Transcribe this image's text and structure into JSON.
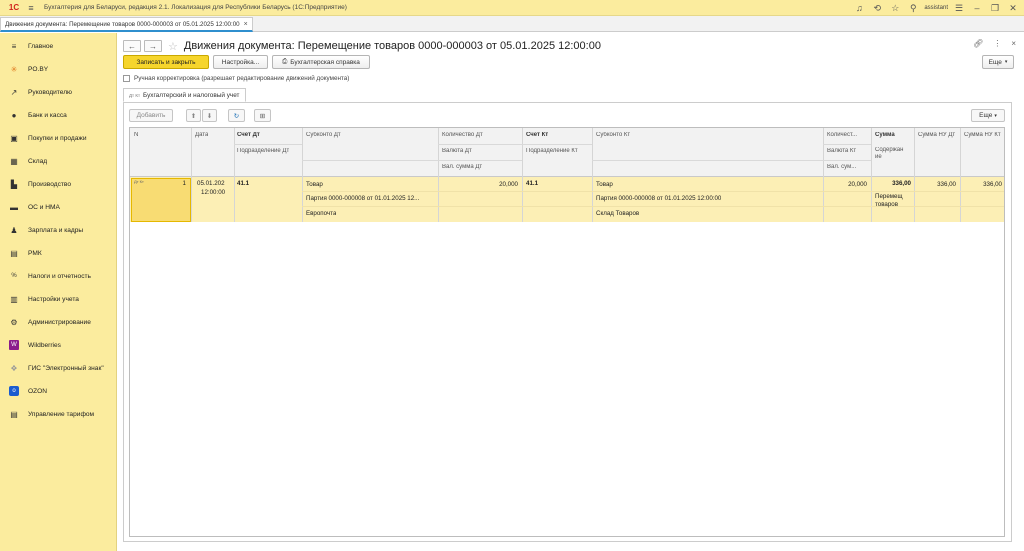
{
  "app": {
    "title": "Бухгалтерия для Беларуси, редакция 2.1. Локализация для Республики Беларусь  (1С:Предприятие)",
    "user": "assistant",
    "logo": "1С"
  },
  "tab": {
    "label": "Движения документа: Перемещение товаров 0000-000003 от 05.01.2025 12:00:00"
  },
  "sidebar": {
    "items": [
      {
        "label": "Главное",
        "icon": "hamburger-icon"
      },
      {
        "label": "PO.BY",
        "icon": "sparkle-icon"
      },
      {
        "label": "Руководителю",
        "icon": "trend-icon"
      },
      {
        "label": "Банк и касса",
        "icon": "bank-icon"
      },
      {
        "label": "Покупки и продажи",
        "icon": "cart-icon"
      },
      {
        "label": "Склад",
        "icon": "warehouse-icon"
      },
      {
        "label": "Производство",
        "icon": "factory-icon"
      },
      {
        "label": "ОС и НМА",
        "icon": "truck-icon"
      },
      {
        "label": "Зарплата и кадры",
        "icon": "person-icon"
      },
      {
        "label": "РМК",
        "icon": "register-icon"
      },
      {
        "label": "Налоги и отчетность",
        "icon": "tax-icon"
      },
      {
        "label": "Настройки учета",
        "icon": "folder-icon"
      },
      {
        "label": "Администрирование",
        "icon": "gear-icon"
      },
      {
        "label": "Wildberries",
        "icon": "wb-icon"
      },
      {
        "label": "ГИС \"Электронный знак\"",
        "icon": "diamond-icon"
      },
      {
        "label": "OZON",
        "icon": "ozon-icon"
      },
      {
        "label": "Управление тарифом",
        "icon": "list-icon"
      }
    ]
  },
  "header": {
    "title": "Движения документа: Перемещение товаров 0000-000003 от 05.01.2025 12:00:00"
  },
  "toolbar": {
    "save_close": "Записать и закрыть",
    "settings": "Настройка...",
    "report": "Бухгалтерская справка",
    "more": "Еще"
  },
  "manual": {
    "label": "Ручная корректировка (разрешает редактирование движений документа)"
  },
  "subtab": {
    "label": "Бухгалтерский и налоговый учет",
    "icon_text": "Дт Кт"
  },
  "panel": {
    "add": "Добавить",
    "more": "Еще"
  },
  "grid": {
    "headers": {
      "n": "N",
      "date": "Дата",
      "acc_dt": "Счет Дт",
      "div_dt": "Подразделение Дт",
      "sub_dt": "Субконто Дт",
      "qty_dt": "Количество Дт",
      "cur_dt": "Валюта Дт",
      "cur_sum_dt": "Вал. сумма Дт",
      "acc_kt": "Счет Кт",
      "div_kt": "Подразделение Кт",
      "sub_kt": "Субконто Кт",
      "qty_kt": "Количест...",
      "cur_kt": "Валюта Кт",
      "cur_sum_kt": "Вал. сум...",
      "sum": "Сумма",
      "content": "Содержан ие",
      "sum_nu_dt": "Сумма НУ Дт",
      "sum_nu_kt": "Сумма НУ Кт"
    },
    "row": {
      "icon_text": "Дт Кт",
      "n": "1",
      "date": "05.01.202",
      "time": "12:00:00",
      "acc_dt": "41.1",
      "sub_dt_1": "Товар",
      "sub_dt_2": "Партия 0000-000008 от 01.01.2025 12...",
      "sub_dt_3": "Европочта",
      "qty_dt": "20,000",
      "acc_kt": "41.1",
      "sub_kt_1": "Товар",
      "sub_kt_2": "Партия 0000-000008 от 01.01.2025 12:00:00",
      "sub_kt_3": "Склад Товаров",
      "qty_kt": "20,000",
      "sum": "336,00",
      "content": "Перемещ товаров",
      "sum_nu_dt": "336,00",
      "sum_nu_kt": "336,00"
    }
  }
}
